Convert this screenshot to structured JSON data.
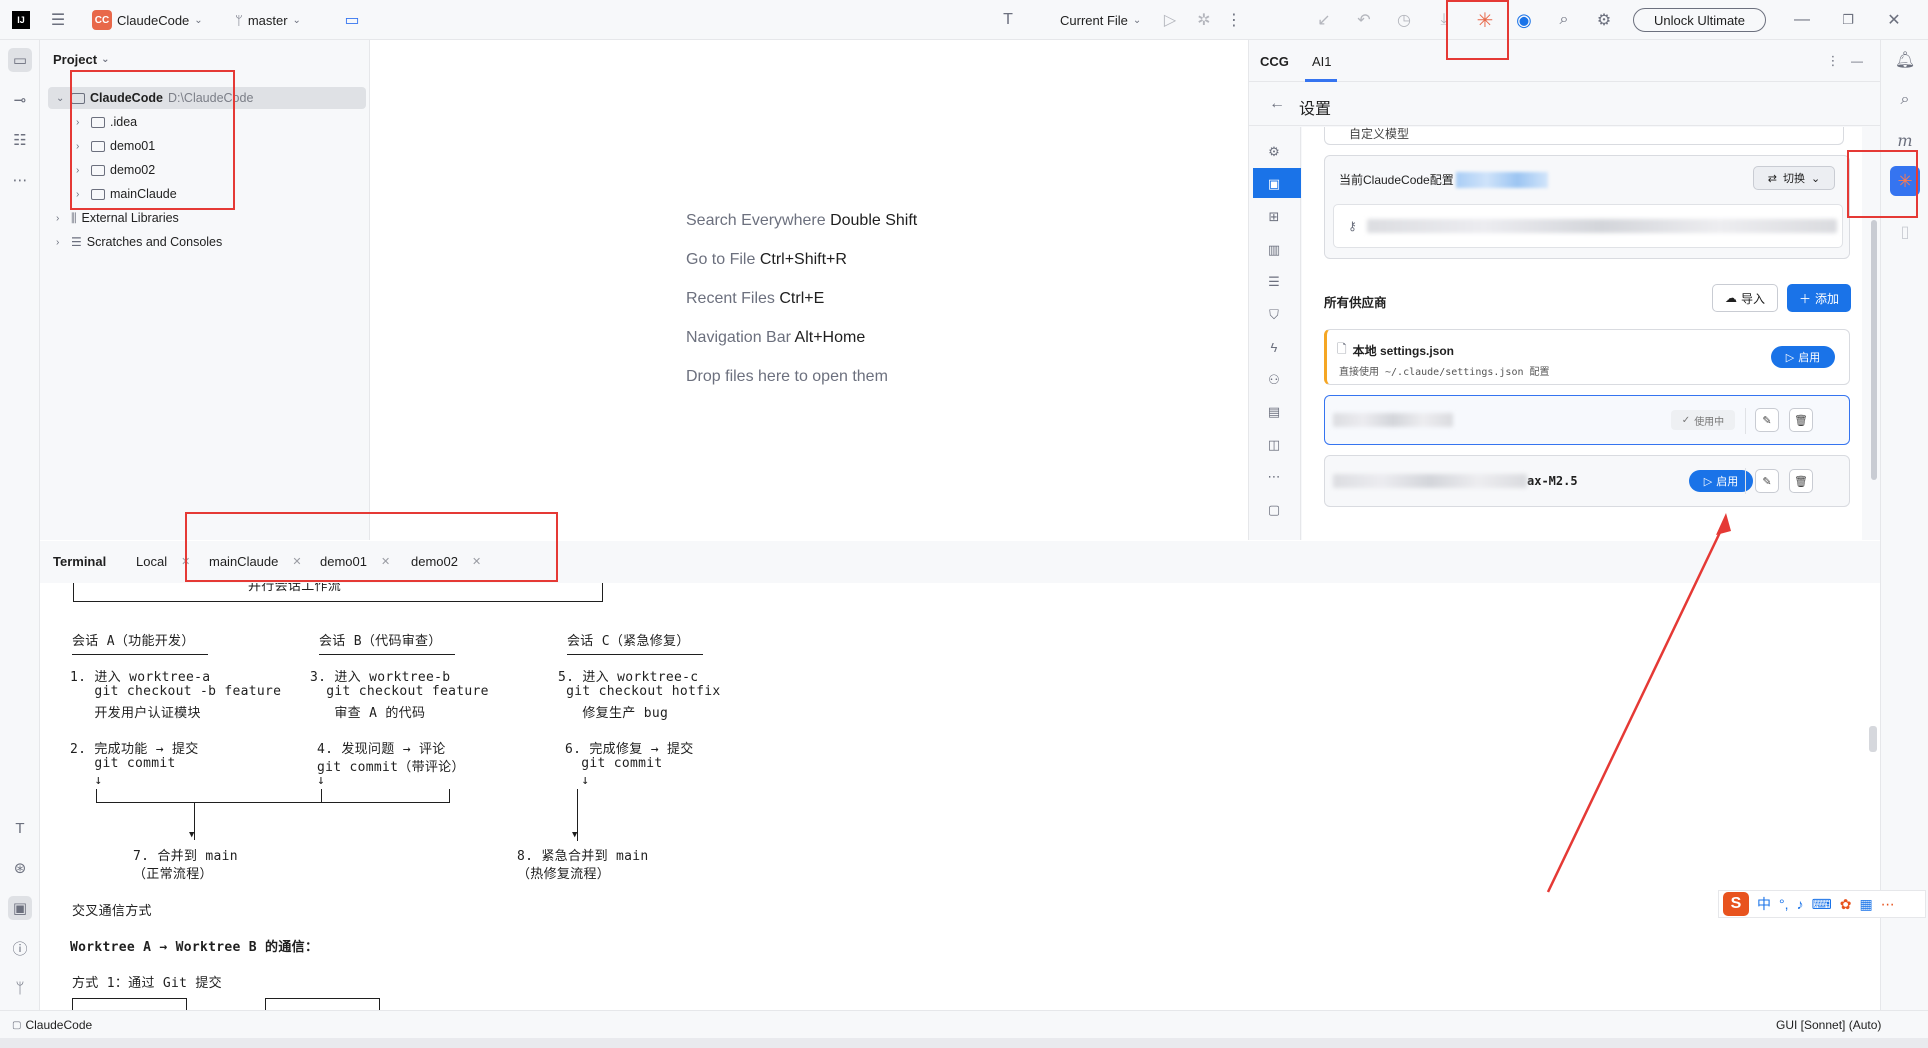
{
  "topbar": {
    "project_badge": "CC",
    "project_name": "ClaudeCode",
    "branch": "master",
    "run_config": "Current File",
    "unlock_label": "Unlock Ultimate"
  },
  "project_panel": {
    "title": "Project",
    "root_name": "ClaudeCode",
    "root_path": "D:\\ClaudeCode",
    "folders": [
      ".idea",
      "demo01",
      "demo02",
      "mainClaude"
    ],
    "external_libraries": "External Libraries",
    "scratches": "Scratches and Consoles"
  },
  "editor_hints": [
    {
      "label": "Search Everywhere",
      "shortcut": "Double Shift"
    },
    {
      "label": "Go to File",
      "shortcut": "Ctrl+Shift+R"
    },
    {
      "label": "Recent Files",
      "shortcut": "Ctrl+E"
    },
    {
      "label": "Navigation Bar",
      "shortcut": "Alt+Home"
    },
    {
      "label": "Drop files here to open them",
      "shortcut": ""
    }
  ],
  "ccg": {
    "tabs": [
      "CCG",
      "AI1"
    ],
    "settings_title": "设置",
    "partial_top_label": "自定义模型",
    "current_config_label": "当前ClaudeCode配置",
    "switch_label": "切换",
    "providers_title": "所有供应商",
    "import_label": "导入",
    "add_label": "添加",
    "providers": [
      {
        "name": "本地 settings.json",
        "desc": "直接使用 ~/.claude/settings.json 配置",
        "action": "启用"
      },
      {
        "name": "",
        "desc": "",
        "action": "使用中"
      },
      {
        "name": "ax-M2.5",
        "desc": "",
        "action": "启用"
      }
    ]
  },
  "terminal": {
    "title": "Terminal",
    "tabs": [
      "Local",
      "mainClaude",
      "demo01",
      "demo02"
    ],
    "header_fragment": "并行会话工作流",
    "session_a_title": "会话 A（功能开发）",
    "session_b_title": "会话 B（代码审查）",
    "session_c_title": "会话 C（紧急修复）",
    "a_lines": [
      "1. 进入 worktree-a",
      "   git checkout -b feature",
      "   开发用户认证模块",
      "",
      "2. 完成功能 → 提交",
      "   git commit",
      "   ↓"
    ],
    "b_lines": [
      "3. 进入 worktree-b",
      "  git checkout feature",
      "   审查 A 的代码",
      "",
      "4. 发现问题 → 评论",
      "git commit（带评论）",
      "↓"
    ],
    "c_lines": [
      "5. 进入 worktree-c",
      " git checkout hotfix",
      "   修复生产 bug",
      "",
      "6. 完成修复 → 提交",
      "  git commit",
      "  ↓"
    ],
    "merge_main": [
      "7. 合并到 main",
      "（正常流程）"
    ],
    "merge_hotfix": [
      "8. 紧急合并到 main",
      "（热修复流程）"
    ],
    "cross_title": "交叉通信方式",
    "worktree_comm": "Worktree A → Worktree B 的通信：",
    "method1": "方式 1：通过 Git 提交"
  },
  "statusbar": {
    "project": "ClaudeCode",
    "right": "GUI [Sonnet] (Auto)"
  },
  "ime": {
    "label": "中"
  }
}
